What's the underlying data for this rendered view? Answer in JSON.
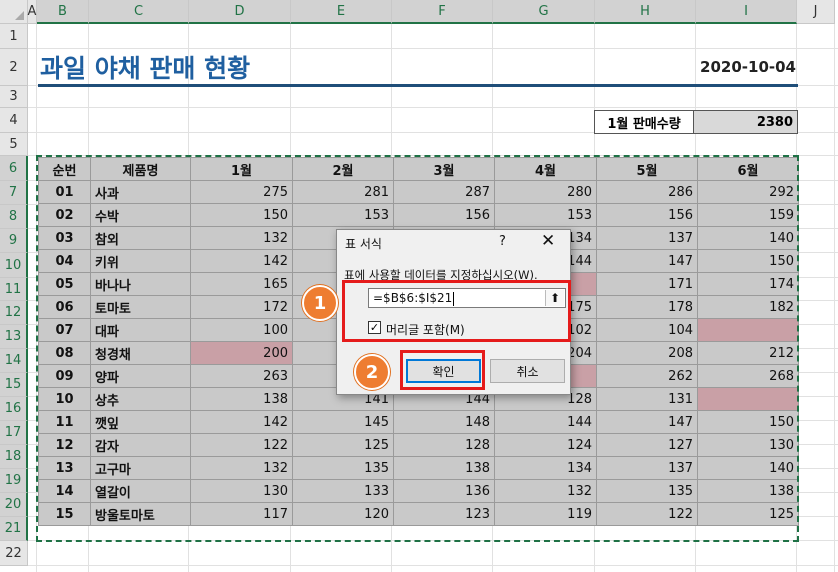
{
  "columns": [
    "A",
    "B",
    "C",
    "D",
    "E",
    "F",
    "G",
    "H",
    "I",
    "J"
  ],
  "rows": [
    "1",
    "2",
    "3",
    "4",
    "5",
    "6",
    "7",
    "8",
    "9",
    "10",
    "11",
    "12",
    "13",
    "14",
    "15",
    "16",
    "17",
    "18",
    "19",
    "20",
    "21",
    "22"
  ],
  "sheet": {
    "title": "과일 야채 판매 현황",
    "date": "2020-10-04",
    "summary_label": "1월 판매수량",
    "summary_value": "2380"
  },
  "table": {
    "headers": [
      "순번",
      "제품명",
      "1월",
      "2월",
      "3월",
      "4월",
      "5월",
      "6월"
    ],
    "rows": [
      [
        "01",
        "사과",
        "275",
        "281",
        "287",
        "280",
        "286",
        "292"
      ],
      [
        "02",
        "수박",
        "150",
        "153",
        "156",
        "153",
        "156",
        "159"
      ],
      [
        "03",
        "참외",
        "132",
        "",
        "",
        "134",
        "137",
        "140"
      ],
      [
        "04",
        "키위",
        "142",
        "",
        "",
        "144",
        "147",
        "150"
      ],
      [
        "05",
        "바나나",
        "165",
        "",
        "",
        "",
        "171",
        "174"
      ],
      [
        "06",
        "토마토",
        "172",
        "",
        "",
        "175",
        "178",
        "182"
      ],
      [
        "07",
        "대파",
        "100",
        "",
        "",
        "102",
        "104",
        ""
      ],
      [
        "08",
        "청경채",
        "200",
        "",
        "",
        "204",
        "208",
        "212"
      ],
      [
        "09",
        "양파",
        "263",
        "",
        "",
        "",
        "262",
        "268"
      ],
      [
        "10",
        "상추",
        "138",
        "141",
        "144",
        "128",
        "131",
        ""
      ],
      [
        "11",
        "깻잎",
        "142",
        "145",
        "148",
        "144",
        "147",
        "150"
      ],
      [
        "12",
        "감자",
        "122",
        "125",
        "128",
        "124",
        "127",
        "130"
      ],
      [
        "13",
        "고구마",
        "132",
        "135",
        "138",
        "134",
        "137",
        "140"
      ],
      [
        "14",
        "열갈이",
        "130",
        "133",
        "136",
        "132",
        "135",
        "138"
      ],
      [
        "15",
        "방울토마토",
        "117",
        "120",
        "123",
        "119",
        "122",
        "125"
      ]
    ],
    "pink_cells": [
      [
        4,
        5
      ],
      [
        6,
        7
      ],
      [
        7,
        2
      ],
      [
        8,
        5
      ],
      [
        9,
        7
      ]
    ]
  },
  "dialog": {
    "title": "표 서식",
    "help": "?",
    "close": "✕",
    "prompt": "표에 사용할 데이터를 지정하십시오(W).",
    "range_value": "=$B$6:$I$21",
    "collapse_icon": "⬆",
    "checkbox_label": "머리글 포함(M)",
    "checkbox_mark": "✓",
    "ok_label": "확인",
    "cancel_label": "취소"
  },
  "annotations": {
    "badge1": "1",
    "badge2": "2"
  },
  "colors": {
    "title_blue": "#1f5fa0",
    "selection_green": "#1e7145",
    "highlight_red": "#e51b1b",
    "badge_orange": "#ee7d31"
  }
}
